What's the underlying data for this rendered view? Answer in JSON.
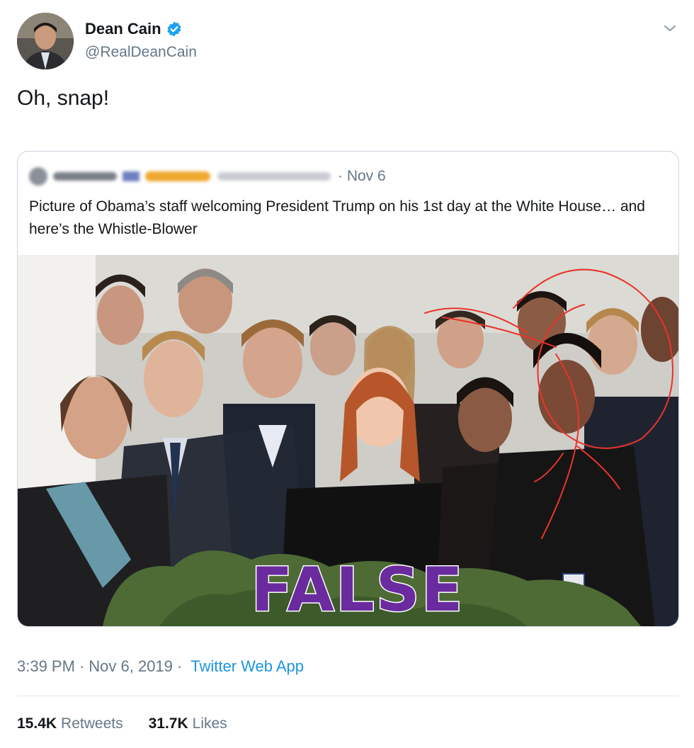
{
  "author": {
    "display_name": "Dean Cain",
    "handle": "@RealDeanCain",
    "verified": true,
    "avatar_icon": "profile-photo"
  },
  "tweet": {
    "text": "Oh, snap!"
  },
  "quoted_tweet": {
    "date": "· Nov 6",
    "text": "Picture of Obama’s staff welcoming President Trump on his 1st day at the White House… and here’s the Whistle-Blower",
    "image": {
      "overlay_label": "FALSE",
      "overlay_color": "#6a2b9e",
      "annotation_color": "#e8342c"
    }
  },
  "meta": {
    "time": "3:39 PM",
    "date": "Nov 6, 2019",
    "source": "Twitter Web App"
  },
  "stats": {
    "retweets_count": "15.4K",
    "retweets_label": "Retweets",
    "likes_count": "31.7K",
    "likes_label": "Likes"
  },
  "colors": {
    "link": "#1b95e0",
    "verified": "#1da1f2",
    "secondary_text": "#657786"
  }
}
